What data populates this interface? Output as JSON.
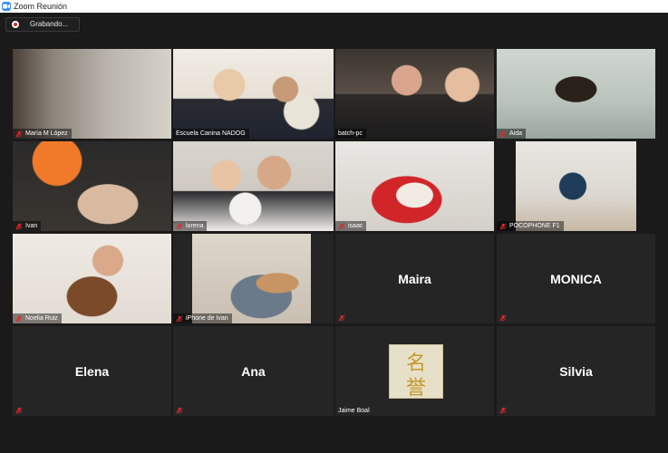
{
  "window": {
    "title": "Zoom Reunión"
  },
  "recording": {
    "label": "Grabando..."
  },
  "colors": {
    "active_border": "#a6e35b",
    "muted_mic": "#e02828",
    "tile_bg": "#252525"
  },
  "participants": [
    {
      "name": "María M López",
      "muted": true,
      "video": true
    },
    {
      "name": "Escuela Canina NADOG",
      "muted": false,
      "video": true,
      "active_speaker": true
    },
    {
      "name": "batch-pc",
      "muted": false,
      "video": true
    },
    {
      "name": "Aida",
      "muted": true,
      "video": true
    },
    {
      "name": "Ivan",
      "muted": true,
      "video": true
    },
    {
      "name": "lorena",
      "muted": true,
      "video": true
    },
    {
      "name": "isaac",
      "muted": true,
      "video": true
    },
    {
      "name": "POCOPHONE F1",
      "muted": true,
      "video": true
    },
    {
      "name": "Noelia Ruiz",
      "muted": true,
      "video": true
    },
    {
      "name": "iPhone de Ivan",
      "muted": true,
      "video": true
    },
    {
      "name": "Maira",
      "muted": true,
      "video": false
    },
    {
      "name": "MONICA",
      "muted": true,
      "video": false
    },
    {
      "name": "Elena",
      "muted": true,
      "video": false
    },
    {
      "name": "Ana",
      "muted": true,
      "video": false
    },
    {
      "name": "Jaime Boal",
      "muted": false,
      "video": false,
      "avatar_text": [
        "名",
        "誉"
      ]
    },
    {
      "name": "Silvia",
      "muted": true,
      "video": false
    }
  ]
}
